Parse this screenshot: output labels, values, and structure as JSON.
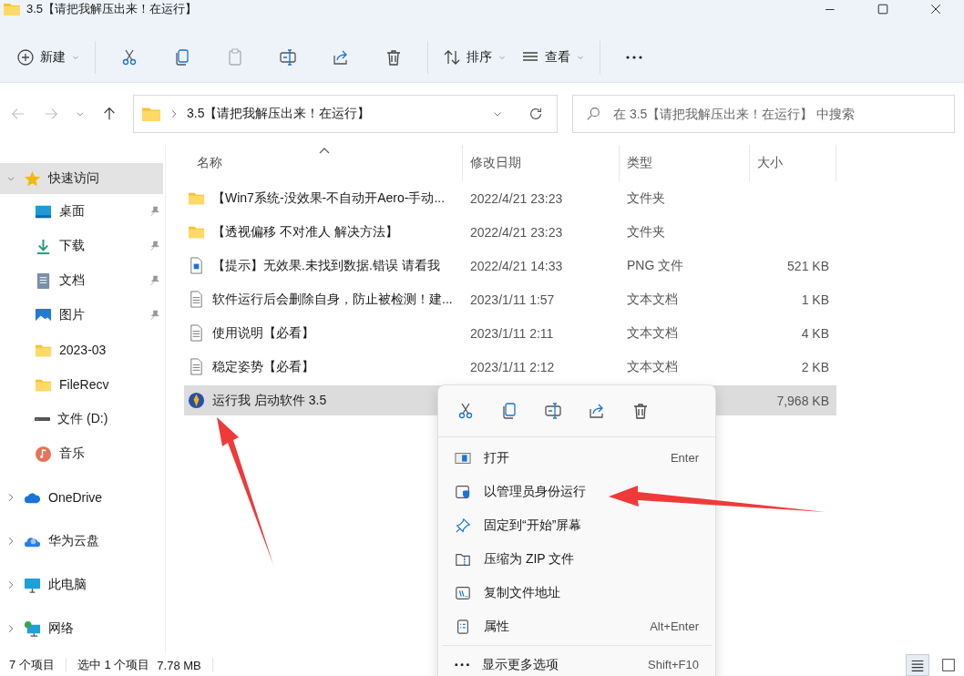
{
  "window": {
    "title": "3.5【请把我解压出来！在运行】",
    "controls": [
      {
        "kind": "minimize"
      },
      {
        "kind": "maximize"
      },
      {
        "kind": "close"
      }
    ]
  },
  "toolbar": [
    {
      "kind": "new",
      "label": "新建",
      "disabled": false,
      "menu": true
    },
    {
      "kind": "cut",
      "disabled": false
    },
    {
      "kind": "copy",
      "disabled": false
    },
    {
      "kind": "paste",
      "disabled": true
    },
    {
      "kind": "rename",
      "disabled": false
    },
    {
      "kind": "share",
      "disabled": false
    },
    {
      "kind": "delete",
      "disabled": false
    },
    {
      "kind": "sort",
      "label": "排序",
      "disabled": false,
      "menu": true
    },
    {
      "kind": "view",
      "label": "查看",
      "disabled": false,
      "menu": true
    },
    {
      "kind": "more",
      "disabled": false
    }
  ],
  "navigation": {
    "back_disabled": true,
    "forward_disabled": true,
    "path": "3.5【请把我解压出来！在运行】",
    "search": {
      "placeholder": "在 3.5【请把我解压出来！在运行】 中搜索"
    }
  },
  "sidebar": {
    "items": [
      {
        "kind": "star",
        "label": "快速访问",
        "expanded": true,
        "selected": true,
        "children": [
          {
            "kind": "desktop",
            "label": "桌面",
            "pinned": true,
            "selected": false
          },
          {
            "kind": "download",
            "label": "下载",
            "pinned": true,
            "selected": false
          },
          {
            "kind": "documents",
            "label": "文档",
            "pinned": true,
            "selected": false
          },
          {
            "kind": "pictures",
            "label": "图片",
            "pinned": true,
            "selected": false
          },
          {
            "kind": "folder",
            "label": "2023-03",
            "pinned": false,
            "selected": false
          },
          {
            "kind": "folder",
            "label": "FileRecv",
            "pinned": false,
            "selected": false
          },
          {
            "kind": "drive",
            "label": "文件 (D:)",
            "pinned": false,
            "selected": false
          },
          {
            "kind": "music",
            "label": "音乐",
            "pinned": false,
            "selected": false
          }
        ]
      },
      {
        "kind": "cloud",
        "label": "OneDrive",
        "expanded": false,
        "selected": false
      },
      {
        "kind": "cloud2",
        "label": "华为云盘",
        "expanded": false,
        "selected": false
      },
      {
        "kind": "pc",
        "label": "此电脑",
        "expanded": false,
        "selected": false
      },
      {
        "kind": "network",
        "label": "网络",
        "expanded": false,
        "selected": false
      }
    ]
  },
  "table": {
    "columns": [
      {
        "label": "名称",
        "sorted": true
      },
      {
        "label": "修改日期",
        "sorted": false
      },
      {
        "label": "类型",
        "sorted": false
      },
      {
        "label": "大小",
        "sorted": false
      }
    ],
    "rows": [
      {
        "kind": "folder",
        "name": "【Win7系统-没效果-不自动开Aero-手动...",
        "date": "2022/4/21 23:23",
        "type": "文件夹",
        "selected": false
      },
      {
        "kind": "folder",
        "name": "【透视偏移 不对准人 解决方法】",
        "date": "2022/4/21 23:23",
        "type": "文件夹",
        "selected": false
      },
      {
        "kind": "png",
        "name": "【提示】无效果.未找到数据.错误 请看我",
        "date": "2022/4/21 14:33",
        "type": "PNG 文件",
        "size": "521 KB",
        "selected": false
      },
      {
        "kind": "txt",
        "name": "软件运行后会删除自身，防止被检测！建...",
        "date": "2023/1/11 1:57",
        "type": "文本文档",
        "size": "1 KB",
        "selected": false
      },
      {
        "kind": "txt",
        "name": "使用说明【必看】",
        "date": "2023/1/11 2:11",
        "type": "文本文档",
        "size": "4 KB",
        "selected": false
      },
      {
        "kind": "txt",
        "name": "稳定姿势【必看】",
        "date": "2023/1/11 2:12",
        "type": "文本文档",
        "size": "2 KB",
        "selected": false
      },
      {
        "kind": "exe",
        "name": "运行我 启动软件 3.5",
        "size": "7,968 KB",
        "selected": true
      }
    ]
  },
  "context_menu": {
    "actions": [
      {
        "kind": "cut"
      },
      {
        "kind": "copy"
      },
      {
        "kind": "rename"
      },
      {
        "kind": "share"
      },
      {
        "kind": "delete"
      }
    ],
    "items": [
      {
        "kind": "open",
        "label": "打开",
        "shortcut": "Enter"
      },
      {
        "kind": "admin",
        "label": "以管理员身份运行"
      },
      {
        "kind": "pin",
        "label": "固定到“开始”屏幕"
      },
      {
        "kind": "zip",
        "label": "压缩为 ZIP 文件"
      },
      {
        "kind": "path",
        "label": "复制文件地址"
      },
      {
        "kind": "props",
        "label": "属性",
        "shortcut": "Alt+Enter",
        "divider_after": true
      },
      {
        "kind": "more",
        "label": "显示更多选项",
        "shortcut": "Shift+F10"
      }
    ]
  },
  "status_bar": {
    "count": "7 个项目",
    "selection": "选中 1 个项目",
    "size": "7.78 MB",
    "views": [
      {
        "kind": "details",
        "selected": true
      },
      {
        "kind": "tiles",
        "selected": false
      }
    ]
  }
}
